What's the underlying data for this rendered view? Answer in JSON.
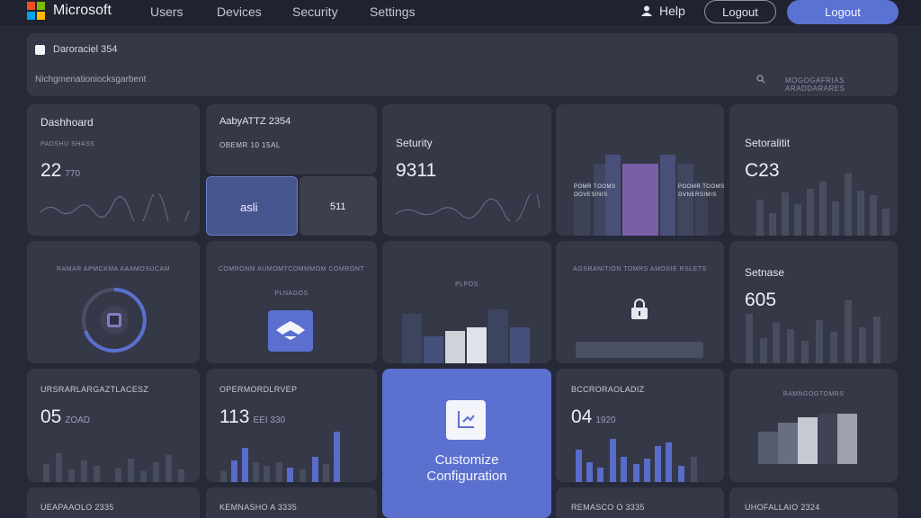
{
  "nav": {
    "brand": "Microsoft",
    "links": [
      "Users",
      "Devices",
      "Security",
      "Settings"
    ],
    "help": "Help",
    "logout_outline": "Logout",
    "logout_primary": "Logout"
  },
  "filter": {
    "checkbox_label": "Daroraciel 354",
    "text": "Nichgmenationiocksgarbent",
    "meta": "MOGOGAFRIAS ARADDARARES"
  },
  "cards": {
    "dashboard": {
      "title": "Dashhoard",
      "sub": "PADSHU SHASS",
      "value": "22",
      "value_sm": "770"
    },
    "aaby": {
      "title": "AabyATTZ 2354",
      "sub": "OBEMR 10 15AL",
      "seg_a": "asli",
      "seg_b": "511"
    },
    "security": {
      "title": "Seturity",
      "value": "9311"
    },
    "bars_purple": {
      "left_label": "POMR TOOMS\nOOVESINIS",
      "right_label": "POOMR TOOMS\nGVNERSIMIS"
    },
    "setoralitit": {
      "title": "Setoralitit",
      "value": "C23"
    },
    "donut": {
      "sub": "RAMAR APMCKMA AAAMOSUCAM"
    },
    "share": {
      "sub": "COMRONM AUMOMTCOMMMOM COMRONT",
      "sub2": "PLNAGOS"
    },
    "levels": {
      "sub": "PLPOS"
    },
    "lock": {
      "sub": "AGSRANITION TOMRS AMOSIE RSLETS"
    },
    "setnase": {
      "title": "Setnase",
      "value": "605"
    },
    "row3a": {
      "title": "URSRARLARGAZTLACESZ",
      "value": "05",
      "value_sm": "ZOAD"
    },
    "row3b": {
      "title": "OPERMORDLRVEP",
      "value": "113",
      "value_sm": "EEI 330"
    },
    "customize": {
      "line1": "Customize",
      "line2": "Configuration"
    },
    "row3d": {
      "title": "BCCRORAOLADIZ",
      "value": "04",
      "value_sm": "1920"
    },
    "row3e": {
      "sub": "RAMNGOGTOMRS"
    },
    "row4a": {
      "title": "UEAPAAOLO 2335"
    },
    "row4b": {
      "title": "KEMNASHO A 3335"
    },
    "row4d": {
      "title": "REMASCO O 3335"
    },
    "row4e": {
      "title": "UHOFALLAIO 2324"
    }
  },
  "colors": {
    "accent": "#5b70cf",
    "card": "#343847",
    "background": "#262937"
  }
}
